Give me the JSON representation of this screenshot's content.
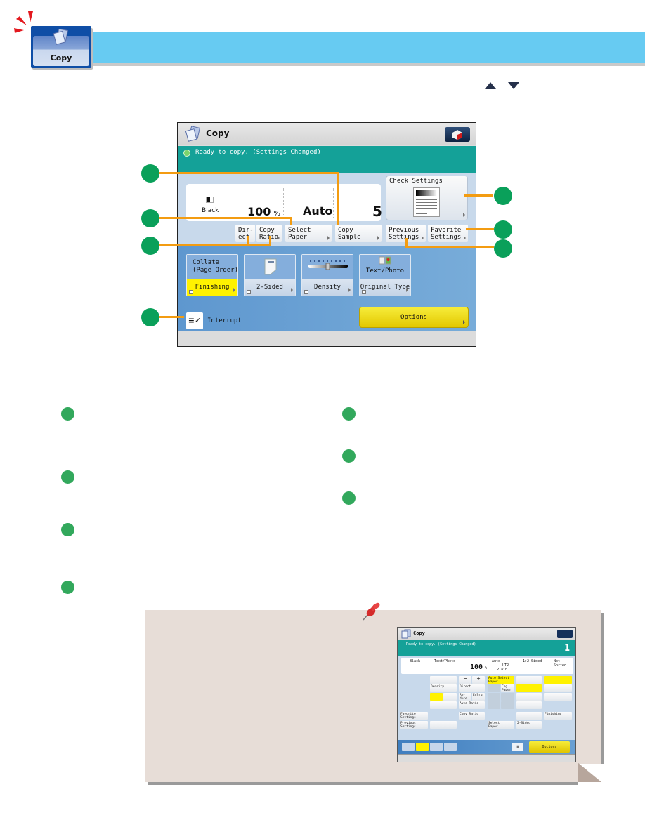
{
  "header": {
    "tab_label": "Copy",
    "bar_color": "#67cbf2",
    "tab_color": "#0f4ea6"
  },
  "nav_arrows": [
    "up-arrow",
    "down-arrow"
  ],
  "screen": {
    "title": "Copy",
    "status_text": "Ready to copy. (Settings Changed)",
    "status_color": "#14a198",
    "settings_panel": {
      "color_mode": "Black",
      "copy_ratio": "100",
      "copy_ratio_unit": "%",
      "paper": "Auto",
      "copies": "5"
    },
    "buttons": {
      "direct": "Dir-\nect",
      "copy_ratio": "Copy\nRatio",
      "select_paper": "Select Paper",
      "copy_sample": "Copy\nSample",
      "check_settings": "Check Settings",
      "previous_settings": "Previous\nSettings",
      "favorite_settings": "Favorite\nSettings"
    },
    "function_keys": [
      {
        "top_label": "Collate\n(Page Order)",
        "label": "Finishing",
        "highlight": true
      },
      {
        "top_label": "",
        "label": "2-Sided",
        "highlight": false
      },
      {
        "top_label": "",
        "label": "Density",
        "highlight": false
      },
      {
        "top_label": "Text/Photo",
        "label": "Original Type",
        "highlight": false
      }
    ],
    "interrupt_label": "Interrupt",
    "options_label": "Options"
  },
  "callouts": {
    "markers": 7,
    "line_color": "#f39c11",
    "dot_color": "#0aa05a"
  },
  "description_bullets": {
    "left_count": 4,
    "right_count": 3,
    "color": "#32a85c"
  },
  "note": {
    "background": "#e7ddd7",
    "mini_screen": {
      "title": "Copy",
      "status_text": "Ready to copy. (Settings Changed)",
      "copies": "1",
      "panel": {
        "color": "Black",
        "original_type": "Text/Photo",
        "ratio": "100",
        "ratio_unit": "%",
        "paper_auto": "Auto",
        "paper_size": "LTR",
        "paper_type": "Plain",
        "two_sided": "1>2-Sided",
        "finishing": "Not Sorted"
      },
      "cells": {
        "density": "Density",
        "minus": "−",
        "plus": "+",
        "direct": "Direct",
        "reduce": "Re-\nduce",
        "enlarge": "Enlrg",
        "auto_ratio": "Auto Ratio",
        "copy_ratio": "Copy Ratio",
        "auto_select_paper": "Auto Select\nPaper",
        "chg_paper": "Chg.\nPaper",
        "favorite_settings": "Favorite\nSettings",
        "previous_settings": "Previous\nSettings",
        "select_paper": "Select\nPaper",
        "two_sided": "2-Sided",
        "finishing": "Finishing",
        "options": "Options"
      }
    }
  }
}
